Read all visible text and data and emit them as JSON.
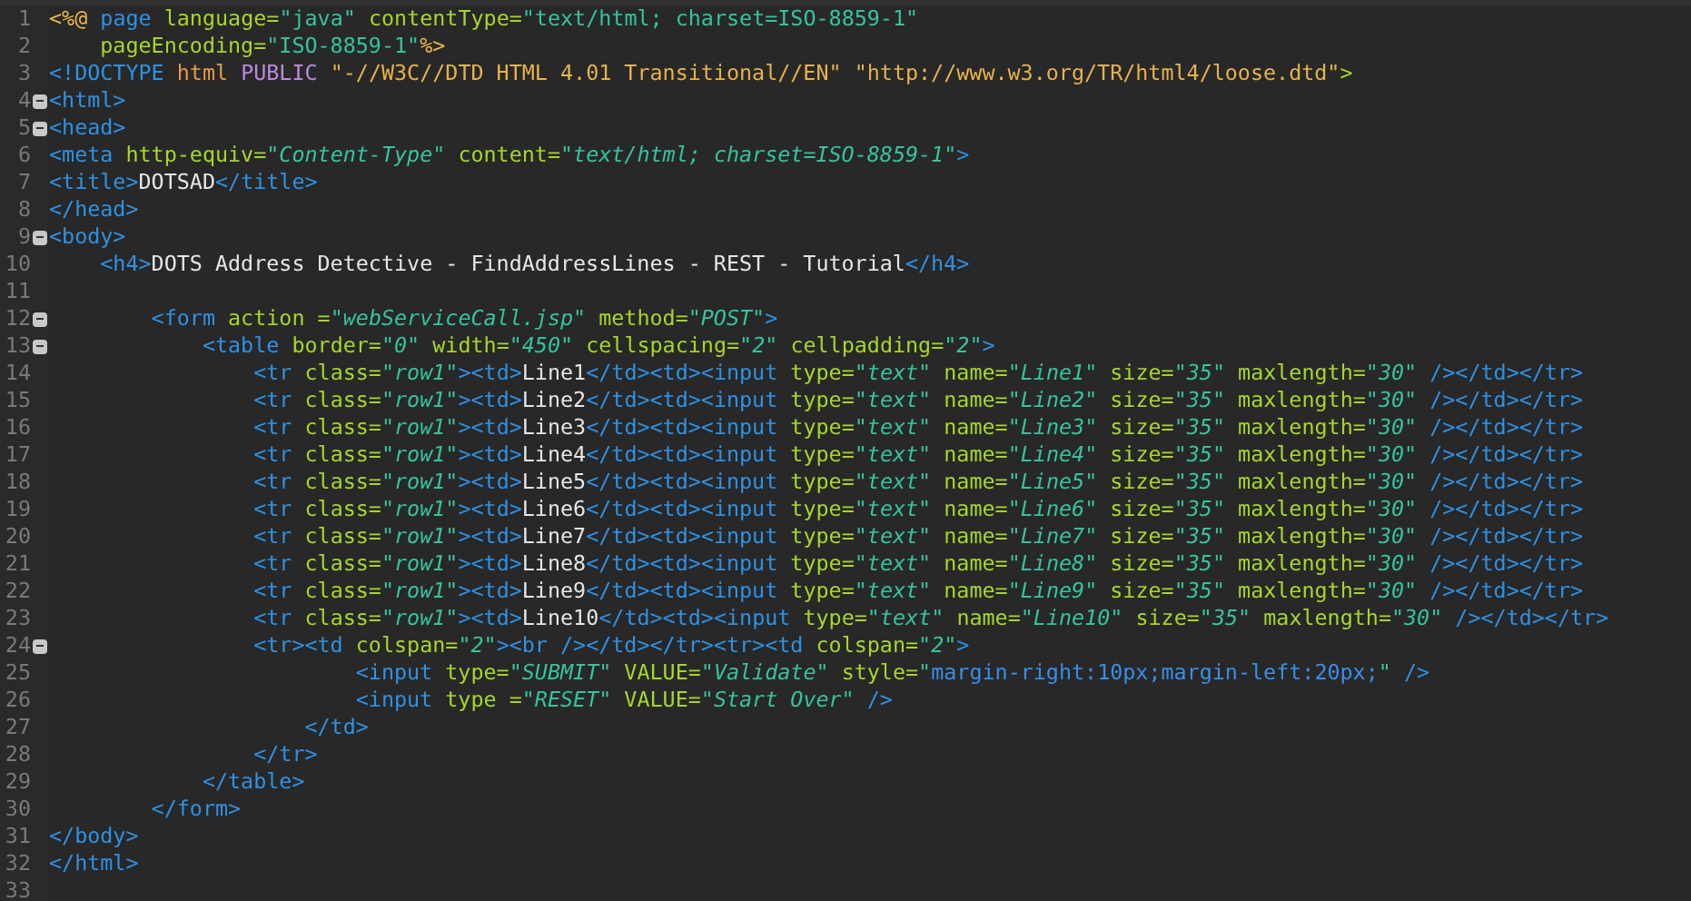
{
  "editor": {
    "lines": [
      {
        "number": "1",
        "foldable": false,
        "tokens": [
          {
            "kind": "jsp",
            "text": "<%@"
          },
          {
            "kind": "tag",
            "text": " page"
          },
          {
            "kind": "attr",
            "text": " language="
          },
          {
            "kind": "str",
            "text": "\"java\""
          },
          {
            "kind": "attr",
            "text": " contentType="
          },
          {
            "kind": "str",
            "text": "\"text/html; charset=ISO-8859-1\""
          }
        ]
      },
      {
        "number": "2",
        "foldable": false,
        "tokens": [
          {
            "kind": "attr",
            "text": "    pageEncoding="
          },
          {
            "kind": "str",
            "text": "\"ISO-8859-1\""
          },
          {
            "kind": "jsp",
            "text": "%>"
          }
        ]
      },
      {
        "number": "3",
        "foldable": false,
        "tokens": [
          {
            "kind": "tag",
            "text": "<!DOCTYPE"
          },
          {
            "kind": "doc",
            "text": " html"
          },
          {
            "kind": "pub",
            "text": " PUBLIC"
          },
          {
            "kind": "docstr",
            "text": " \"-//W3C//DTD HTML 4.01 Transitional//EN\""
          },
          {
            "kind": "docstr",
            "text": " \"http://www.w3.org/TR/html4/loose.dtd\""
          },
          {
            "kind": "attr",
            "text": ">"
          }
        ]
      },
      {
        "number": "4",
        "foldable": true,
        "tokens": [
          {
            "kind": "tag",
            "text": "<html>"
          }
        ]
      },
      {
        "number": "5",
        "foldable": true,
        "tokens": [
          {
            "kind": "tag",
            "text": "<head>"
          }
        ]
      },
      {
        "number": "6",
        "foldable": false,
        "tokens": [
          {
            "kind": "tag",
            "text": "<meta"
          },
          {
            "kind": "attr",
            "text": " http-equiv="
          },
          {
            "kind": "istr",
            "text": "\"Content-Type\""
          },
          {
            "kind": "attr",
            "text": " content="
          },
          {
            "kind": "istr",
            "text": "\"text/html; charset=ISO-8859-1\""
          },
          {
            "kind": "tag",
            "text": ">"
          }
        ]
      },
      {
        "number": "7",
        "foldable": false,
        "tokens": [
          {
            "kind": "tag",
            "text": "<title>"
          },
          {
            "kind": "text",
            "text": "DOTSAD"
          },
          {
            "kind": "tag",
            "text": "</title>"
          }
        ]
      },
      {
        "number": "8",
        "foldable": false,
        "tokens": [
          {
            "kind": "tag",
            "text": "</head>"
          }
        ]
      },
      {
        "number": "9",
        "foldable": true,
        "tokens": [
          {
            "kind": "tag",
            "text": "<body>"
          }
        ]
      },
      {
        "number": "10",
        "foldable": false,
        "tokens": [
          {
            "kind": "tag",
            "text": "    <h4>"
          },
          {
            "kind": "text",
            "text": "DOTS Address Detective - FindAddressLines - REST - Tutorial"
          },
          {
            "kind": "tag",
            "text": "</h4>"
          }
        ]
      },
      {
        "number": "11",
        "foldable": false
      },
      {
        "number": "12",
        "foldable": true,
        "tokens": [
          {
            "kind": "tag",
            "text": "        <form"
          },
          {
            "kind": "attr",
            "text": " action ="
          },
          {
            "kind": "istr",
            "text": "\"webServiceCall.jsp\""
          },
          {
            "kind": "attr",
            "text": " method="
          },
          {
            "kind": "istr",
            "text": "\"POST\""
          },
          {
            "kind": "tag",
            "text": ">"
          }
        ]
      },
      {
        "number": "13",
        "foldable": true,
        "tokens": [
          {
            "kind": "tag",
            "text": "            <table"
          },
          {
            "kind": "attr",
            "text": " border="
          },
          {
            "kind": "istr",
            "text": "\"0\""
          },
          {
            "kind": "attr",
            "text": " width="
          },
          {
            "kind": "istr",
            "text": "\"450\""
          },
          {
            "kind": "attr",
            "text": " cellspacing="
          },
          {
            "kind": "istr",
            "text": "\"2\""
          },
          {
            "kind": "attr",
            "text": " cellpadding="
          },
          {
            "kind": "istr",
            "text": "\"2\""
          },
          {
            "kind": "tag",
            "text": ">"
          }
        ]
      },
      {
        "number": "14",
        "foldable": false,
        "tokens": [
          {
            "kind": "tag",
            "text": "                <tr"
          },
          {
            "kind": "attr",
            "text": " class="
          },
          {
            "kind": "istr",
            "text": "\"row1\""
          },
          {
            "kind": "tag",
            "text": "><td>"
          },
          {
            "kind": "text",
            "text": "Line1"
          },
          {
            "kind": "tag",
            "text": "</td><td><input"
          },
          {
            "kind": "attr",
            "text": " type="
          },
          {
            "kind": "istr",
            "text": "\"text\""
          },
          {
            "kind": "attr",
            "text": " name="
          },
          {
            "kind": "istr",
            "text": "\"Line1\""
          },
          {
            "kind": "attr",
            "text": " size="
          },
          {
            "kind": "istr",
            "text": "\"35\""
          },
          {
            "kind": "attr",
            "text": " maxlength="
          },
          {
            "kind": "istr",
            "text": "\"30\""
          },
          {
            "kind": "tag",
            "text": " /></td></tr>"
          }
        ]
      },
      {
        "number": "15",
        "foldable": false,
        "tokens": [
          {
            "kind": "tag",
            "text": "                <tr"
          },
          {
            "kind": "attr",
            "text": " class="
          },
          {
            "kind": "istr",
            "text": "\"row1\""
          },
          {
            "kind": "tag",
            "text": "><td>"
          },
          {
            "kind": "text",
            "text": "Line2"
          },
          {
            "kind": "tag",
            "text": "</td><td><input"
          },
          {
            "kind": "attr",
            "text": " type="
          },
          {
            "kind": "istr",
            "text": "\"text\""
          },
          {
            "kind": "attr",
            "text": " name="
          },
          {
            "kind": "istr",
            "text": "\"Line2\""
          },
          {
            "kind": "attr",
            "text": " size="
          },
          {
            "kind": "istr",
            "text": "\"35\""
          },
          {
            "kind": "attr",
            "text": " maxlength="
          },
          {
            "kind": "istr",
            "text": "\"30\""
          },
          {
            "kind": "tag",
            "text": " /></td></tr>"
          }
        ]
      },
      {
        "number": "16",
        "foldable": false,
        "tokens": [
          {
            "kind": "tag",
            "text": "                <tr"
          },
          {
            "kind": "attr",
            "text": " class="
          },
          {
            "kind": "istr",
            "text": "\"row1\""
          },
          {
            "kind": "tag",
            "text": "><td>"
          },
          {
            "kind": "text",
            "text": "Line3"
          },
          {
            "kind": "tag",
            "text": "</td><td><input"
          },
          {
            "kind": "attr",
            "text": " type="
          },
          {
            "kind": "istr",
            "text": "\"text\""
          },
          {
            "kind": "attr",
            "text": " name="
          },
          {
            "kind": "istr",
            "text": "\"Line3\""
          },
          {
            "kind": "attr",
            "text": " size="
          },
          {
            "kind": "istr",
            "text": "\"35\""
          },
          {
            "kind": "attr",
            "text": " maxlength="
          },
          {
            "kind": "istr",
            "text": "\"30\""
          },
          {
            "kind": "tag",
            "text": " /></td></tr>"
          }
        ]
      },
      {
        "number": "17",
        "foldable": false,
        "tokens": [
          {
            "kind": "tag",
            "text": "                <tr"
          },
          {
            "kind": "attr",
            "text": " class="
          },
          {
            "kind": "istr",
            "text": "\"row1\""
          },
          {
            "kind": "tag",
            "text": "><td>"
          },
          {
            "kind": "text",
            "text": "Line4"
          },
          {
            "kind": "tag",
            "text": "</td><td><input"
          },
          {
            "kind": "attr",
            "text": " type="
          },
          {
            "kind": "istr",
            "text": "\"text\""
          },
          {
            "kind": "attr",
            "text": " name="
          },
          {
            "kind": "istr",
            "text": "\"Line4\""
          },
          {
            "kind": "attr",
            "text": " size="
          },
          {
            "kind": "istr",
            "text": "\"35\""
          },
          {
            "kind": "attr",
            "text": " maxlength="
          },
          {
            "kind": "istr",
            "text": "\"30\""
          },
          {
            "kind": "tag",
            "text": " /></td></tr>"
          }
        ]
      },
      {
        "number": "18",
        "foldable": false,
        "tokens": [
          {
            "kind": "tag",
            "text": "                <tr"
          },
          {
            "kind": "attr",
            "text": " class="
          },
          {
            "kind": "istr",
            "text": "\"row1\""
          },
          {
            "kind": "tag",
            "text": "><td>"
          },
          {
            "kind": "text",
            "text": "Line5"
          },
          {
            "kind": "tag",
            "text": "</td><td><input"
          },
          {
            "kind": "attr",
            "text": " type="
          },
          {
            "kind": "istr",
            "text": "\"text\""
          },
          {
            "kind": "attr",
            "text": " name="
          },
          {
            "kind": "istr",
            "text": "\"Line5\""
          },
          {
            "kind": "attr",
            "text": " size="
          },
          {
            "kind": "istr",
            "text": "\"35\""
          },
          {
            "kind": "attr",
            "text": " maxlength="
          },
          {
            "kind": "istr",
            "text": "\"30\""
          },
          {
            "kind": "tag",
            "text": " /></td></tr>"
          }
        ]
      },
      {
        "number": "19",
        "foldable": false,
        "tokens": [
          {
            "kind": "tag",
            "text": "                <tr"
          },
          {
            "kind": "attr",
            "text": " class="
          },
          {
            "kind": "istr",
            "text": "\"row1\""
          },
          {
            "kind": "tag",
            "text": "><td>"
          },
          {
            "kind": "text",
            "text": "Line6"
          },
          {
            "kind": "tag",
            "text": "</td><td><input"
          },
          {
            "kind": "attr",
            "text": " type="
          },
          {
            "kind": "istr",
            "text": "\"text\""
          },
          {
            "kind": "attr",
            "text": " name="
          },
          {
            "kind": "istr",
            "text": "\"Line6\""
          },
          {
            "kind": "attr",
            "text": " size="
          },
          {
            "kind": "istr",
            "text": "\"35\""
          },
          {
            "kind": "attr",
            "text": " maxlength="
          },
          {
            "kind": "istr",
            "text": "\"30\""
          },
          {
            "kind": "tag",
            "text": " /></td></tr>"
          }
        ]
      },
      {
        "number": "20",
        "foldable": false,
        "tokens": [
          {
            "kind": "tag",
            "text": "                <tr"
          },
          {
            "kind": "attr",
            "text": " class="
          },
          {
            "kind": "istr",
            "text": "\"row1\""
          },
          {
            "kind": "tag",
            "text": "><td>"
          },
          {
            "kind": "text",
            "text": "Line7"
          },
          {
            "kind": "tag",
            "text": "</td><td><input"
          },
          {
            "kind": "attr",
            "text": " type="
          },
          {
            "kind": "istr",
            "text": "\"text\""
          },
          {
            "kind": "attr",
            "text": " name="
          },
          {
            "kind": "istr",
            "text": "\"Line7\""
          },
          {
            "kind": "attr",
            "text": " size="
          },
          {
            "kind": "istr",
            "text": "\"35\""
          },
          {
            "kind": "attr",
            "text": " maxlength="
          },
          {
            "kind": "istr",
            "text": "\"30\""
          },
          {
            "kind": "tag",
            "text": " /></td></tr>"
          }
        ]
      },
      {
        "number": "21",
        "foldable": false,
        "tokens": [
          {
            "kind": "tag",
            "text": "                <tr"
          },
          {
            "kind": "attr",
            "text": " class="
          },
          {
            "kind": "istr",
            "text": "\"row1\""
          },
          {
            "kind": "tag",
            "text": "><td>"
          },
          {
            "kind": "text",
            "text": "Line8"
          },
          {
            "kind": "tag",
            "text": "</td><td><input"
          },
          {
            "kind": "attr",
            "text": " type="
          },
          {
            "kind": "istr",
            "text": "\"text\""
          },
          {
            "kind": "attr",
            "text": " name="
          },
          {
            "kind": "istr",
            "text": "\"Line8\""
          },
          {
            "kind": "attr",
            "text": " size="
          },
          {
            "kind": "istr",
            "text": "\"35\""
          },
          {
            "kind": "attr",
            "text": " maxlength="
          },
          {
            "kind": "istr",
            "text": "\"30\""
          },
          {
            "kind": "tag",
            "text": " /></td></tr>"
          }
        ]
      },
      {
        "number": "22",
        "foldable": false,
        "tokens": [
          {
            "kind": "tag",
            "text": "                <tr"
          },
          {
            "kind": "attr",
            "text": " class="
          },
          {
            "kind": "istr",
            "text": "\"row1\""
          },
          {
            "kind": "tag",
            "text": "><td>"
          },
          {
            "kind": "text",
            "text": "Line9"
          },
          {
            "kind": "tag",
            "text": "</td><td><input"
          },
          {
            "kind": "attr",
            "text": " type="
          },
          {
            "kind": "istr",
            "text": "\"text\""
          },
          {
            "kind": "attr",
            "text": " name="
          },
          {
            "kind": "istr",
            "text": "\"Line9\""
          },
          {
            "kind": "attr",
            "text": " size="
          },
          {
            "kind": "istr",
            "text": "\"35\""
          },
          {
            "kind": "attr",
            "text": " maxlength="
          },
          {
            "kind": "istr",
            "text": "\"30\""
          },
          {
            "kind": "tag",
            "text": " /></td></tr>"
          }
        ]
      },
      {
        "number": "23",
        "foldable": false,
        "tokens": [
          {
            "kind": "tag",
            "text": "                <tr"
          },
          {
            "kind": "attr",
            "text": " class="
          },
          {
            "kind": "istr",
            "text": "\"row1\""
          },
          {
            "kind": "tag",
            "text": "><td>"
          },
          {
            "kind": "text",
            "text": "Line10"
          },
          {
            "kind": "tag",
            "text": "</td><td><input"
          },
          {
            "kind": "attr",
            "text": " type="
          },
          {
            "kind": "istr",
            "text": "\"text\""
          },
          {
            "kind": "attr",
            "text": " name="
          },
          {
            "kind": "istr",
            "text": "\"Line10\""
          },
          {
            "kind": "attr",
            "text": " size="
          },
          {
            "kind": "istr",
            "text": "\"35\""
          },
          {
            "kind": "attr",
            "text": " maxlength="
          },
          {
            "kind": "istr",
            "text": "\"30\""
          },
          {
            "kind": "tag",
            "text": " /></td></tr>"
          }
        ]
      },
      {
        "number": "24",
        "foldable": true,
        "tokens": [
          {
            "kind": "tag",
            "text": "                <tr><td"
          },
          {
            "kind": "attr",
            "text": " colspan="
          },
          {
            "kind": "istr",
            "text": "\"2\""
          },
          {
            "kind": "tag",
            "text": "><br /></td></tr><tr><td"
          },
          {
            "kind": "attr",
            "text": " colspan="
          },
          {
            "kind": "istr",
            "text": "\"2\""
          },
          {
            "kind": "tag",
            "text": ">"
          }
        ]
      },
      {
        "number": "25",
        "foldable": false,
        "tokens": [
          {
            "kind": "tag",
            "text": "                        <input"
          },
          {
            "kind": "attr",
            "text": " type="
          },
          {
            "kind": "istr",
            "text": "\"SUBMIT\""
          },
          {
            "kind": "attr",
            "text": " VALUE="
          },
          {
            "kind": "istr",
            "text": "\"Validate\""
          },
          {
            "kind": "attr",
            "text": " style="
          },
          {
            "kind": "istr",
            "text": "\""
          },
          {
            "kind": "style",
            "text": "margin-right:10px;margin-left:20px;"
          },
          {
            "kind": "istr",
            "text": "\""
          },
          {
            "kind": "tag",
            "text": " />"
          }
        ]
      },
      {
        "number": "26",
        "foldable": false,
        "tokens": [
          {
            "kind": "tag",
            "text": "                        <input"
          },
          {
            "kind": "attr",
            "text": " type ="
          },
          {
            "kind": "istr",
            "text": "\"RESET\""
          },
          {
            "kind": "attr",
            "text": " VALUE="
          },
          {
            "kind": "istr",
            "text": "\"Start Over\""
          },
          {
            "kind": "tag",
            "text": " />"
          }
        ]
      },
      {
        "number": "27",
        "foldable": false,
        "tokens": [
          {
            "kind": "tag",
            "text": "                    </td>"
          }
        ]
      },
      {
        "number": "28",
        "foldable": false,
        "tokens": [
          {
            "kind": "tag",
            "text": "                </tr>"
          }
        ]
      },
      {
        "number": "29",
        "foldable": false,
        "tokens": [
          {
            "kind": "tag",
            "text": "            </table>"
          }
        ]
      },
      {
        "number": "30",
        "foldable": false,
        "tokens": [
          {
            "kind": "tag",
            "text": "        </form>"
          }
        ]
      },
      {
        "number": "31",
        "foldable": false,
        "tokens": [
          {
            "kind": "tag",
            "text": "</body>"
          }
        ]
      },
      {
        "number": "32",
        "foldable": false,
        "tokens": [
          {
            "kind": "tag",
            "text": "</html>"
          }
        ]
      },
      {
        "number": "33",
        "foldable": false
      }
    ]
  }
}
